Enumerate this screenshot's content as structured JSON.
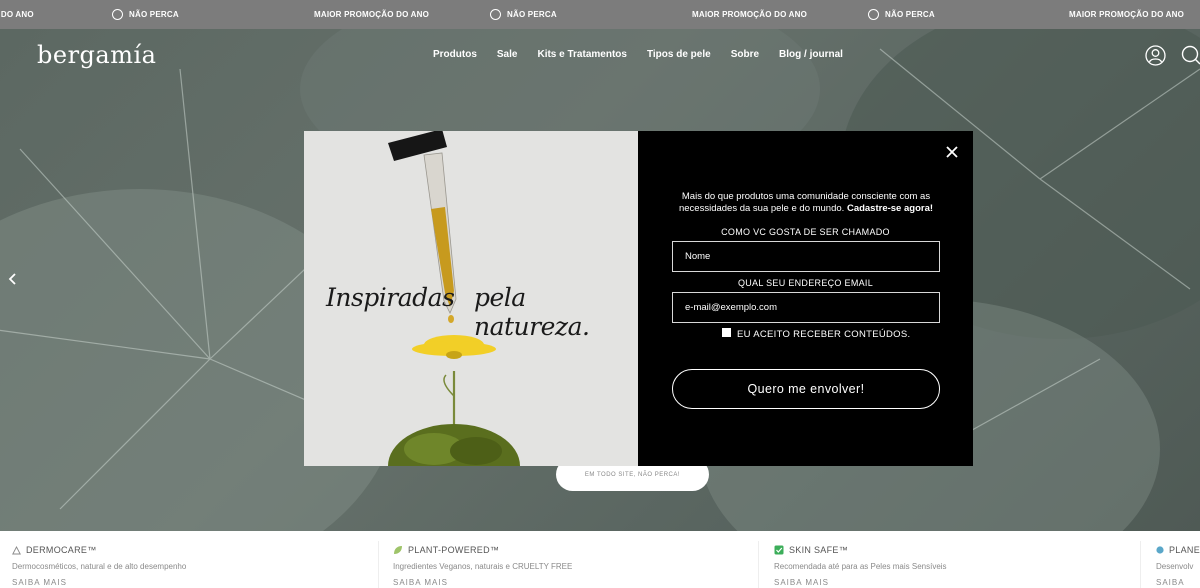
{
  "ticker": {
    "items": [
      {
        "type": "text",
        "label": "O DO ANO"
      },
      {
        "type": "ring",
        "label": "NÃO PERCA"
      },
      {
        "type": "text",
        "label": "MAIOR PROMOÇÃO DO ANO"
      },
      {
        "type": "ring",
        "label": "NÃO PERCA"
      },
      {
        "type": "text",
        "label": "MAIOR PROMOÇÃO DO ANO"
      },
      {
        "type": "ring",
        "label": "NÃO PERCA"
      },
      {
        "type": "text",
        "label": "MAIOR PROMOÇÃO DO ANO"
      }
    ]
  },
  "header": {
    "logo": "bergamía",
    "nav": [
      "Produtos",
      "Sale",
      "Kits e Tratamentos",
      "Tipos de pele",
      "Sobre",
      "Blog / journal"
    ],
    "icons": [
      "user-icon",
      "search-icon"
    ]
  },
  "hero": {
    "cta": "EM TODO SITE, NÃO PERCA!"
  },
  "benefits": [
    {
      "icon": "triangle-icon",
      "title": "DERMOCARE™",
      "desc": "Dermocosméticos, natural e de alto desempenho",
      "more": "SAIBA MAIS"
    },
    {
      "icon": "leaf-icon",
      "title": "PLANT-POWERED™",
      "desc": "Ingredientes Veganos, naturais e  CRUELTY FREE",
      "more": "SAIBA MAIS"
    },
    {
      "icon": "checkbox-icon",
      "title": "SKIN SAFE™",
      "desc": "Recomendada até para as Peles mais Sensíveis",
      "more": "SAIBA MAIS"
    },
    {
      "icon": "planet-icon",
      "title": "PLANE",
      "desc": "Desenvolv",
      "more": "SAIBA"
    }
  ],
  "modal": {
    "headline_left": "Inspiradas",
    "headline_right": "pela natureza.",
    "intro": "Mais do que produtos uma comunidade consciente com as necessidades da sua pele e do mundo.",
    "intro_bold": "Cadastre-se agora!",
    "name_label": "COMO VC GOSTA DE SER CHAMADO",
    "name_placeholder": "Nome",
    "email_label": "QUAL SEU ENDEREÇO EMAIL",
    "email_placeholder": "e-mail@exemplo.com",
    "consent_label": "EU ACEITO RECEBER CONTEÚDOS.",
    "submit_label": "Quero me envolver!"
  },
  "colors": {
    "ticker_bg": "#7c7c7c",
    "modal_bg": "#000000",
    "modal_image_bg": "#e3e3e1",
    "flower": "#f2cf27",
    "moss": "#5a6e1e"
  }
}
